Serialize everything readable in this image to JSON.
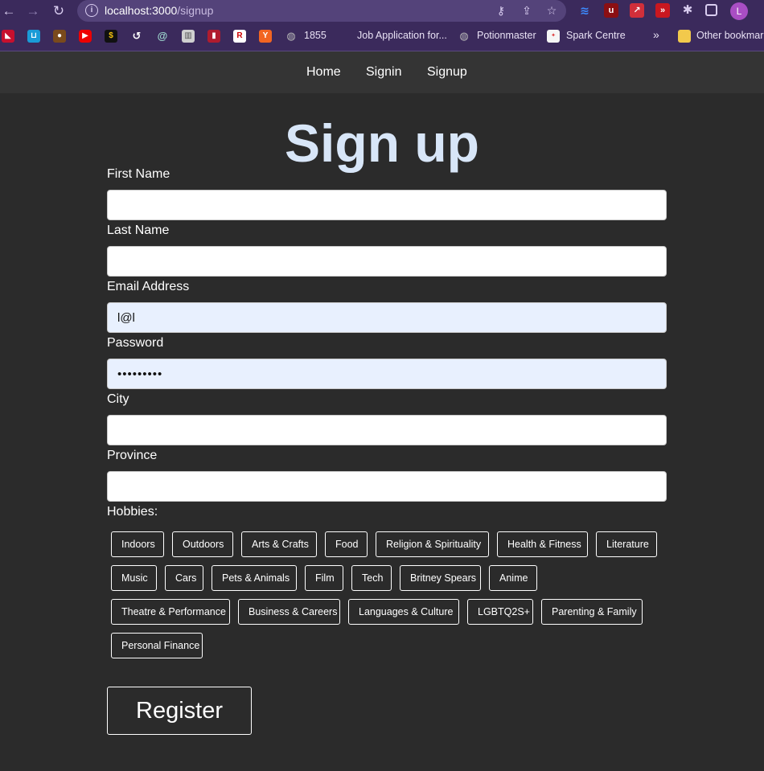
{
  "browser": {
    "url_host": "localhost:3000",
    "url_path": "/signup",
    "profile_initial": "L",
    "bookmarks": [
      {
        "icon": "generic-1-icon",
        "label": ""
      },
      {
        "icon": "cart-icon",
        "label": ""
      },
      {
        "icon": "cookie-icon",
        "label": ""
      },
      {
        "icon": "youtube-icon",
        "label": ""
      },
      {
        "icon": "dollar-icon",
        "label": ""
      },
      {
        "icon": "swirl-icon",
        "label": ""
      },
      {
        "icon": "at-icon",
        "label": ""
      },
      {
        "icon": "book-icon",
        "label": ""
      },
      {
        "icon": "red-book-icon",
        "label": ""
      },
      {
        "icon": "r-icon",
        "label": ""
      },
      {
        "icon": "y-icon",
        "label": ""
      },
      {
        "icon": "globe-icon",
        "label": "1855"
      },
      {
        "icon": "none",
        "label": "Job Application for..."
      },
      {
        "icon": "globe-icon",
        "label": "Potionmaster"
      },
      {
        "icon": "spark-icon",
        "label": "Spark Centre"
      }
    ],
    "other_bookmarks": "Other bookmarks",
    "more_glyph": "»"
  },
  "nav": {
    "home": "Home",
    "signin": "Signin",
    "signup": "Signup"
  },
  "form": {
    "title": "Sign up",
    "first_name_label": "First Name",
    "first_name_value": "",
    "last_name_label": "Last Name",
    "last_name_value": "",
    "email_label": "Email Address",
    "email_value": "l@l",
    "password_label": "Password",
    "password_value": "•••••••••",
    "city_label": "City",
    "city_value": "",
    "province_label": "Province",
    "province_value": "",
    "hobbies_label": "Hobbies:",
    "hobbies": [
      "Indoors",
      "Outdoors",
      "Arts & Crafts",
      "Food",
      "Religion & Spirituality",
      "Health & Fitness",
      "Literature",
      "Music",
      "Cars",
      "Pets & Animals",
      "Film",
      "Tech",
      "Britney Spears",
      "Anime",
      "Theatre & Performance",
      "Business & Careers",
      "Languages & Culture",
      "LGBTQ2S+",
      "Parenting & Family",
      "Personal Finance"
    ],
    "register_label": "Register"
  },
  "colors": {
    "chrome_bg": "#3b2a5c",
    "page_bg": "#2b2b2b",
    "nav_bg": "#343434",
    "title_color": "#d8e6f8",
    "autofill_bg": "#e8f0fe"
  }
}
